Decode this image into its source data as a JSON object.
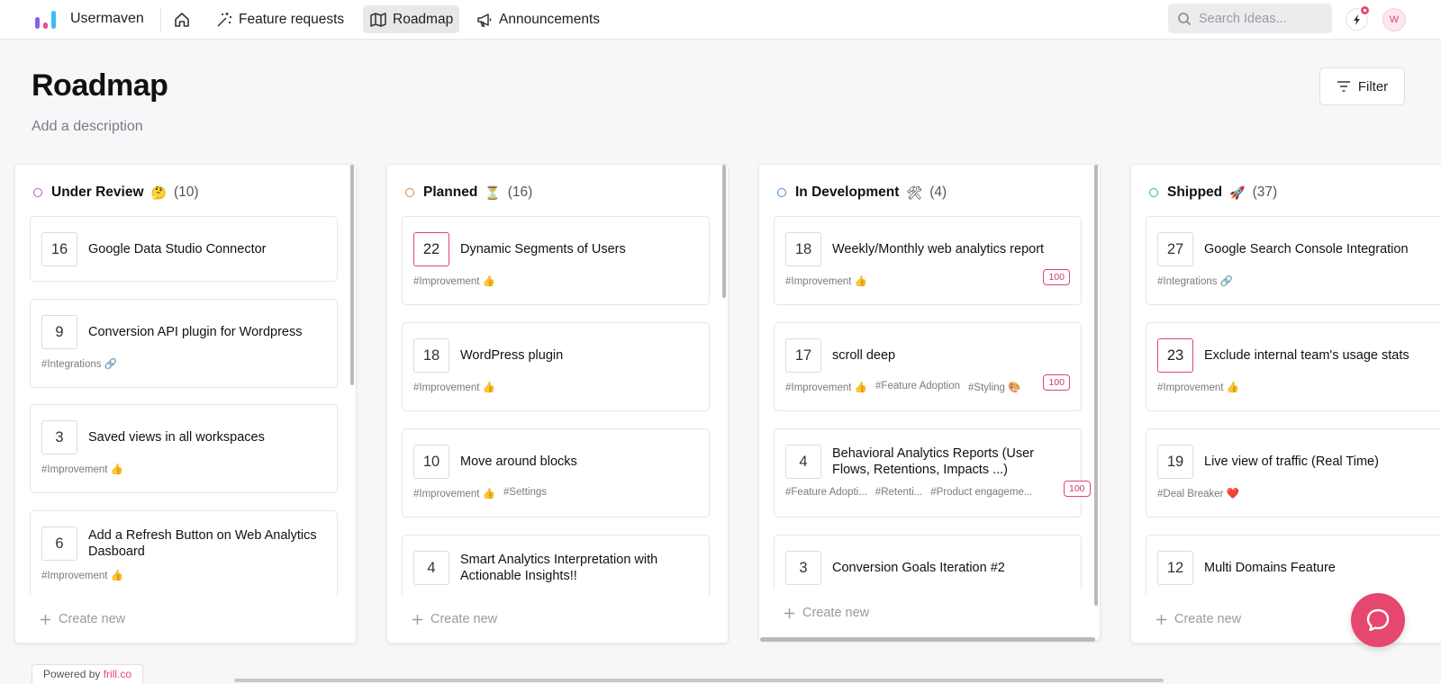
{
  "brand": {
    "name": "Usermaven"
  },
  "nav": {
    "feature_requests": "Feature requests",
    "roadmap": "Roadmap",
    "announcements": "Announcements"
  },
  "search": {
    "placeholder": "Search Ideas..."
  },
  "user": {
    "avatar_initial": "W"
  },
  "page": {
    "title": "Roadmap",
    "description": "Add a description",
    "filter_label": "Filter"
  },
  "create_new_label": "Create new",
  "powered_by": {
    "prefix": "Powered by",
    "link": "frill.co"
  },
  "colors": {
    "accent": "#e5476f",
    "review": "#b455d1",
    "planned": "#e0832c",
    "development": "#4a86c9",
    "shipped": "#2ab3a7"
  },
  "columns": [
    {
      "name": "Under Review",
      "emoji": "🤔",
      "count": "(10)",
      "cards": [
        {
          "votes": "16",
          "title": "Google Data Studio Connector",
          "tags": []
        },
        {
          "votes": "9",
          "title": "Conversion API plugin for Wordpress",
          "tags": [
            "#Integrations 🔗"
          ]
        },
        {
          "votes": "3",
          "title": "Saved views in all workspaces",
          "tags": [
            "#Improvement 👍"
          ]
        },
        {
          "votes": "6",
          "title": "Add a Refresh Button on Web Analytics Dasboard",
          "tags": [
            "#Improvement 👍"
          ]
        }
      ]
    },
    {
      "name": "Planned",
      "emoji": "⏳",
      "count": "(16)",
      "cards": [
        {
          "votes": "22",
          "title": "Dynamic Segments of Users",
          "tags": [
            "#Improvement 👍"
          ]
        },
        {
          "votes": "18",
          "title": "WordPress plugin",
          "tags": [
            "#Improvement 👍"
          ]
        },
        {
          "votes": "10",
          "title": "Move around blocks",
          "tags": [
            "#Improvement 👍",
            "#Settings"
          ]
        },
        {
          "votes": "4",
          "title": "Smart Analytics Interpretation with Actionable Insights!!",
          "tags": []
        }
      ]
    },
    {
      "name": "In Development",
      "emoji": "🛠",
      "count": "(4)",
      "cards": [
        {
          "votes": "18",
          "title": "Weekly/Monthly web analytics report",
          "tags": [
            "#Improvement 👍"
          ],
          "badge": "100"
        },
        {
          "votes": "17",
          "title": "scroll deep",
          "tags": [
            "#Improvement 👍",
            "#Feature Adoption",
            "#Styling 🎨"
          ],
          "badge": "100"
        },
        {
          "votes": "4",
          "title": "Behavioral Analytics Reports (User Flows, Retentions, Impacts ...)",
          "tags": [
            "#Feature Adopti...",
            "#Retenti...",
            "#Product engageme..."
          ],
          "badge": "100"
        },
        {
          "votes": "3",
          "title": "Conversion Goals Iteration #2",
          "tags": []
        }
      ]
    },
    {
      "name": "Shipped",
      "emoji": "🚀",
      "count": "(37)",
      "cards": [
        {
          "votes": "27",
          "title": "Google Search Console Integration",
          "tags": [
            "#Integrations 🔗"
          ]
        },
        {
          "votes": "23",
          "title": "Exclude internal team's usage stats",
          "tags": [
            "#Improvement 👍"
          ]
        },
        {
          "votes": "19",
          "title": "Live view of traffic (Real Time)",
          "tags": [
            "#Deal Breaker ❤️"
          ]
        },
        {
          "votes": "12",
          "title": "Multi Domains Feature",
          "tags": []
        }
      ]
    }
  ]
}
